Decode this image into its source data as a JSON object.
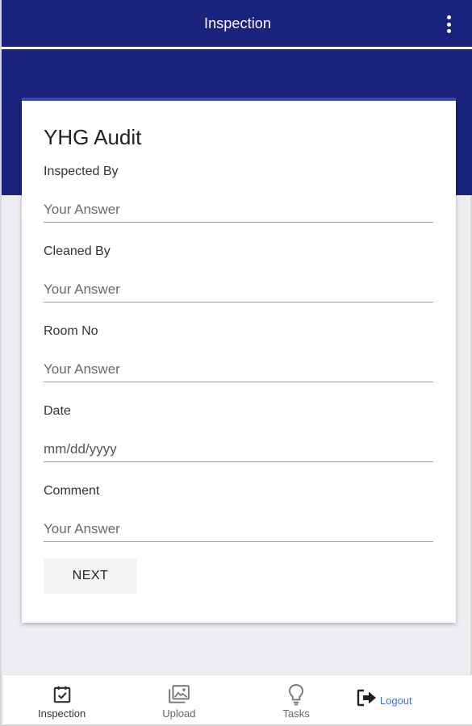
{
  "app_bar": {
    "title": "Inspection",
    "menu_icon": "more-vert-icon"
  },
  "form": {
    "title": "YHG Audit",
    "fields": [
      {
        "label": "Inspected By",
        "placeholder": "Your Answer",
        "value": ""
      },
      {
        "label": "Cleaned By",
        "placeholder": "Your Answer",
        "value": ""
      },
      {
        "label": "Room No",
        "placeholder": "Your Answer",
        "value": ""
      },
      {
        "label": "Date",
        "placeholder": "mm/dd/yyyy",
        "value": ""
      },
      {
        "label": "Comment",
        "placeholder": "Your Answer",
        "value": ""
      }
    ],
    "next_label": "NEXT"
  },
  "bottom_nav": {
    "items": [
      {
        "label": "Inspection",
        "icon": "checklist-icon"
      },
      {
        "label": "Upload",
        "icon": "photo-library-icon"
      },
      {
        "label": "Tasks",
        "icon": "lightbulb-icon"
      },
      {
        "label": "Logout",
        "icon": "logout-icon"
      }
    ]
  },
  "colors": {
    "primary": "#1a237e",
    "accent": "#3949ab",
    "link": "#3f71d6",
    "background": "#eeeef2"
  }
}
